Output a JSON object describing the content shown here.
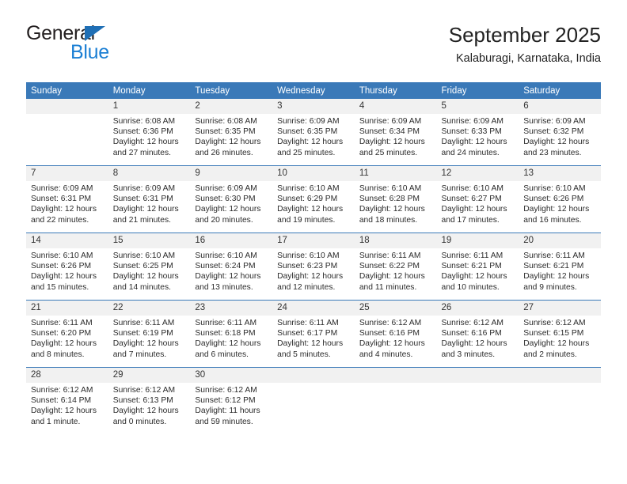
{
  "brand": {
    "name_top": "General",
    "name_bottom": "Blue",
    "color_dark": "#231f20",
    "color_blue": "#1b7fd4",
    "triangle_color": "#1f6fb5"
  },
  "header": {
    "title": "September 2025",
    "subtitle": "Kalaburagi, Karnataka, India"
  },
  "theme": {
    "header_bg": "#3a79b8",
    "header_text": "#ffffff",
    "daynum_bg": "#f1f1f1",
    "rule_color": "#3a79b8"
  },
  "weekdays": [
    "Sunday",
    "Monday",
    "Tuesday",
    "Wednesday",
    "Thursday",
    "Friday",
    "Saturday"
  ],
  "weeks": [
    [
      {
        "day": "",
        "lines": [
          "",
          "",
          "",
          ""
        ],
        "empty": true
      },
      {
        "day": "1",
        "lines": [
          "Sunrise: 6:08 AM",
          "Sunset: 6:36 PM",
          "Daylight: 12 hours",
          "and 27 minutes."
        ]
      },
      {
        "day": "2",
        "lines": [
          "Sunrise: 6:08 AM",
          "Sunset: 6:35 PM",
          "Daylight: 12 hours",
          "and 26 minutes."
        ]
      },
      {
        "day": "3",
        "lines": [
          "Sunrise: 6:09 AM",
          "Sunset: 6:35 PM",
          "Daylight: 12 hours",
          "and 25 minutes."
        ]
      },
      {
        "day": "4",
        "lines": [
          "Sunrise: 6:09 AM",
          "Sunset: 6:34 PM",
          "Daylight: 12 hours",
          "and 25 minutes."
        ]
      },
      {
        "day": "5",
        "lines": [
          "Sunrise: 6:09 AM",
          "Sunset: 6:33 PM",
          "Daylight: 12 hours",
          "and 24 minutes."
        ]
      },
      {
        "day": "6",
        "lines": [
          "Sunrise: 6:09 AM",
          "Sunset: 6:32 PM",
          "Daylight: 12 hours",
          "and 23 minutes."
        ]
      }
    ],
    [
      {
        "day": "7",
        "lines": [
          "Sunrise: 6:09 AM",
          "Sunset: 6:31 PM",
          "Daylight: 12 hours",
          "and 22 minutes."
        ]
      },
      {
        "day": "8",
        "lines": [
          "Sunrise: 6:09 AM",
          "Sunset: 6:31 PM",
          "Daylight: 12 hours",
          "and 21 minutes."
        ]
      },
      {
        "day": "9",
        "lines": [
          "Sunrise: 6:09 AM",
          "Sunset: 6:30 PM",
          "Daylight: 12 hours",
          "and 20 minutes."
        ]
      },
      {
        "day": "10",
        "lines": [
          "Sunrise: 6:10 AM",
          "Sunset: 6:29 PM",
          "Daylight: 12 hours",
          "and 19 minutes."
        ]
      },
      {
        "day": "11",
        "lines": [
          "Sunrise: 6:10 AM",
          "Sunset: 6:28 PM",
          "Daylight: 12 hours",
          "and 18 minutes."
        ]
      },
      {
        "day": "12",
        "lines": [
          "Sunrise: 6:10 AM",
          "Sunset: 6:27 PM",
          "Daylight: 12 hours",
          "and 17 minutes."
        ]
      },
      {
        "day": "13",
        "lines": [
          "Sunrise: 6:10 AM",
          "Sunset: 6:26 PM",
          "Daylight: 12 hours",
          "and 16 minutes."
        ]
      }
    ],
    [
      {
        "day": "14",
        "lines": [
          "Sunrise: 6:10 AM",
          "Sunset: 6:26 PM",
          "Daylight: 12 hours",
          "and 15 minutes."
        ]
      },
      {
        "day": "15",
        "lines": [
          "Sunrise: 6:10 AM",
          "Sunset: 6:25 PM",
          "Daylight: 12 hours",
          "and 14 minutes."
        ]
      },
      {
        "day": "16",
        "lines": [
          "Sunrise: 6:10 AM",
          "Sunset: 6:24 PM",
          "Daylight: 12 hours",
          "and 13 minutes."
        ]
      },
      {
        "day": "17",
        "lines": [
          "Sunrise: 6:10 AM",
          "Sunset: 6:23 PM",
          "Daylight: 12 hours",
          "and 12 minutes."
        ]
      },
      {
        "day": "18",
        "lines": [
          "Sunrise: 6:11 AM",
          "Sunset: 6:22 PM",
          "Daylight: 12 hours",
          "and 11 minutes."
        ]
      },
      {
        "day": "19",
        "lines": [
          "Sunrise: 6:11 AM",
          "Sunset: 6:21 PM",
          "Daylight: 12 hours",
          "and 10 minutes."
        ]
      },
      {
        "day": "20",
        "lines": [
          "Sunrise: 6:11 AM",
          "Sunset: 6:21 PM",
          "Daylight: 12 hours",
          "and 9 minutes."
        ]
      }
    ],
    [
      {
        "day": "21",
        "lines": [
          "Sunrise: 6:11 AM",
          "Sunset: 6:20 PM",
          "Daylight: 12 hours",
          "and 8 minutes."
        ]
      },
      {
        "day": "22",
        "lines": [
          "Sunrise: 6:11 AM",
          "Sunset: 6:19 PM",
          "Daylight: 12 hours",
          "and 7 minutes."
        ]
      },
      {
        "day": "23",
        "lines": [
          "Sunrise: 6:11 AM",
          "Sunset: 6:18 PM",
          "Daylight: 12 hours",
          "and 6 minutes."
        ]
      },
      {
        "day": "24",
        "lines": [
          "Sunrise: 6:11 AM",
          "Sunset: 6:17 PM",
          "Daylight: 12 hours",
          "and 5 minutes."
        ]
      },
      {
        "day": "25",
        "lines": [
          "Sunrise: 6:12 AM",
          "Sunset: 6:16 PM",
          "Daylight: 12 hours",
          "and 4 minutes."
        ]
      },
      {
        "day": "26",
        "lines": [
          "Sunrise: 6:12 AM",
          "Sunset: 6:16 PM",
          "Daylight: 12 hours",
          "and 3 minutes."
        ]
      },
      {
        "day": "27",
        "lines": [
          "Sunrise: 6:12 AM",
          "Sunset: 6:15 PM",
          "Daylight: 12 hours",
          "and 2 minutes."
        ]
      }
    ],
    [
      {
        "day": "28",
        "lines": [
          "Sunrise: 6:12 AM",
          "Sunset: 6:14 PM",
          "Daylight: 12 hours",
          "and 1 minute."
        ]
      },
      {
        "day": "29",
        "lines": [
          "Sunrise: 6:12 AM",
          "Sunset: 6:13 PM",
          "Daylight: 12 hours",
          "and 0 minutes."
        ]
      },
      {
        "day": "30",
        "lines": [
          "Sunrise: 6:12 AM",
          "Sunset: 6:12 PM",
          "Daylight: 11 hours",
          "and 59 minutes."
        ]
      },
      {
        "day": "",
        "lines": [
          "",
          "",
          "",
          ""
        ],
        "empty": true
      },
      {
        "day": "",
        "lines": [
          "",
          "",
          "",
          ""
        ],
        "empty": true
      },
      {
        "day": "",
        "lines": [
          "",
          "",
          "",
          ""
        ],
        "empty": true
      },
      {
        "day": "",
        "lines": [
          "",
          "",
          "",
          ""
        ],
        "empty": true
      }
    ]
  ]
}
